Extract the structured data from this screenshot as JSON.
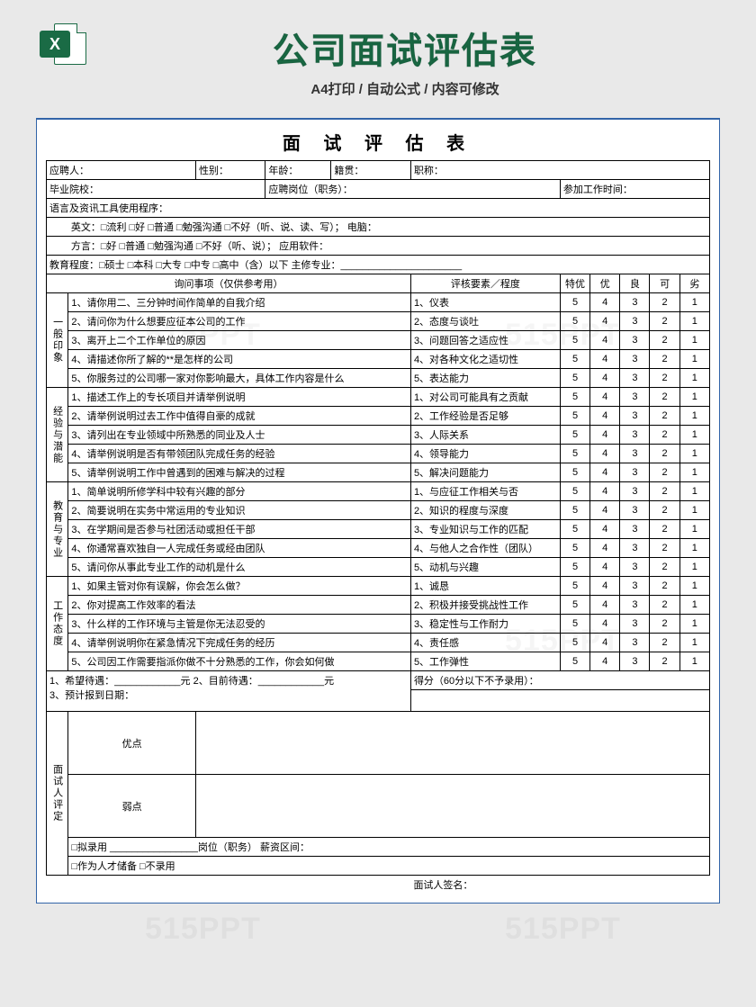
{
  "brand": {
    "icon_letter": "X",
    "watermark": "515PPT"
  },
  "header": {
    "title": "公司面试评估表",
    "subtitle": "A4打印 / 自动公式 / 内容可修改"
  },
  "form": {
    "title": "面 试 评 估 表",
    "row1": {
      "applicant": "应聘人：",
      "gender": "性别：",
      "age": "年龄：",
      "origin": "籍贯：",
      "position": "职称："
    },
    "row2": {
      "school": "毕业院校：",
      "apply_post": "应聘岗位（职务）：",
      "work_time": "参加工作时间："
    },
    "lang_header": "语言及资讯工具使用程序：",
    "lang_en": "英文：□流利  □好  □普通  □勉强沟通  □不好（听、说、读、写）；  电脑：",
    "lang_dialect": "方言：□好  □普通  □勉强沟通  □不好（听、说）；    应用软件：",
    "edu": "教育程度：□硕士  □本科  □大专  □中专  □高中（含）以下    主修专业：______________________",
    "col_headers": {
      "questions": "询问事项（仅供参考用）",
      "criteria": "评核要素／程度",
      "g5": "特优",
      "g4": "优",
      "g3": "良",
      "g2": "可",
      "g1": "劣"
    },
    "sections": [
      {
        "name": "一般印象",
        "rows": [
          {
            "q": "1、请你用二、三分钟时间作简单的自我介绍",
            "c": "1、仪表"
          },
          {
            "q": "2、请问你为什么想要应征本公司的工作",
            "c": "2、态度与谈吐"
          },
          {
            "q": "3、离开上二个工作单位的原因",
            "c": "3、问题回答之适应性"
          },
          {
            "q": "4、请描述你所了解的**是怎样的公司",
            "c": "4、对各种文化之适切性"
          },
          {
            "q": "5、你服务过的公司哪一家对你影响最大，具体工作内容是什么",
            "c": "5、表达能力"
          }
        ]
      },
      {
        "name": "经验与潜能",
        "rows": [
          {
            "q": "1、描述工作上的专长项目并请举例说明",
            "c": "1、对公司可能具有之贡献"
          },
          {
            "q": "2、请举例说明过去工作中值得自豪的成就",
            "c": "2、工作经验是否足够"
          },
          {
            "q": "3、请列出在专业领域中所熟悉的同业及人士",
            "c": "3、人际关系"
          },
          {
            "q": "4、请举例说明是否有带领团队完成任务的经验",
            "c": "4、领导能力"
          },
          {
            "q": "5、请举例说明工作中曾遇到的困难与解决的过程",
            "c": "5、解决问题能力"
          }
        ]
      },
      {
        "name": "教育与专业",
        "rows": [
          {
            "q": "1、简单说明所修学科中较有兴趣的部分",
            "c": "1、与应征工作相关与否"
          },
          {
            "q": "2、简要说明在实务中常运用的专业知识",
            "c": "2、知识的程度与深度"
          },
          {
            "q": "3、在学期间是否参与社团活动或担任干部",
            "c": "3、专业知识与工作的匹配"
          },
          {
            "q": "4、你通常喜欢独自一人完成任务或经由团队",
            "c": "4、与他人之合作性（团队）"
          },
          {
            "q": "5、请问你从事此专业工作的动机是什么",
            "c": "5、动机与兴趣"
          }
        ]
      },
      {
        "name": "工作态度",
        "rows": [
          {
            "q": "1、如果主管对你有误解，你会怎么做？",
            "c": "1、诚恳"
          },
          {
            "q": "2、你对提高工作效率的看法",
            "c": "2、积极并接受挑战性工作"
          },
          {
            "q": "3、什么样的工作环境与主管是你无法忍受的",
            "c": "3、稳定性与工作耐力"
          },
          {
            "q": "4、请举例说明你在紧急情况下完成任务的经历",
            "c": "4、责任感"
          },
          {
            "q": "5、公司因工作需要指派你做不十分熟悉的工作，你会如何做",
            "c": "5、工作弹性"
          }
        ]
      }
    ],
    "scores": [
      "5",
      "4",
      "3",
      "2",
      "1"
    ],
    "score_total": "得分（60分以下不予录用）：",
    "wish_line": "1、希望待遇：____________元    2、目前待遇：____________元",
    "report_line": "3、预计报到日期：",
    "eval_label": "面试人评定",
    "pros": "优点",
    "cons": "弱点",
    "hire_line": "□拟录用 ________________岗位（职务）    薪资区间：",
    "reserve_line": "□作为人才储备                □不录用",
    "sign": "面试人签名："
  }
}
